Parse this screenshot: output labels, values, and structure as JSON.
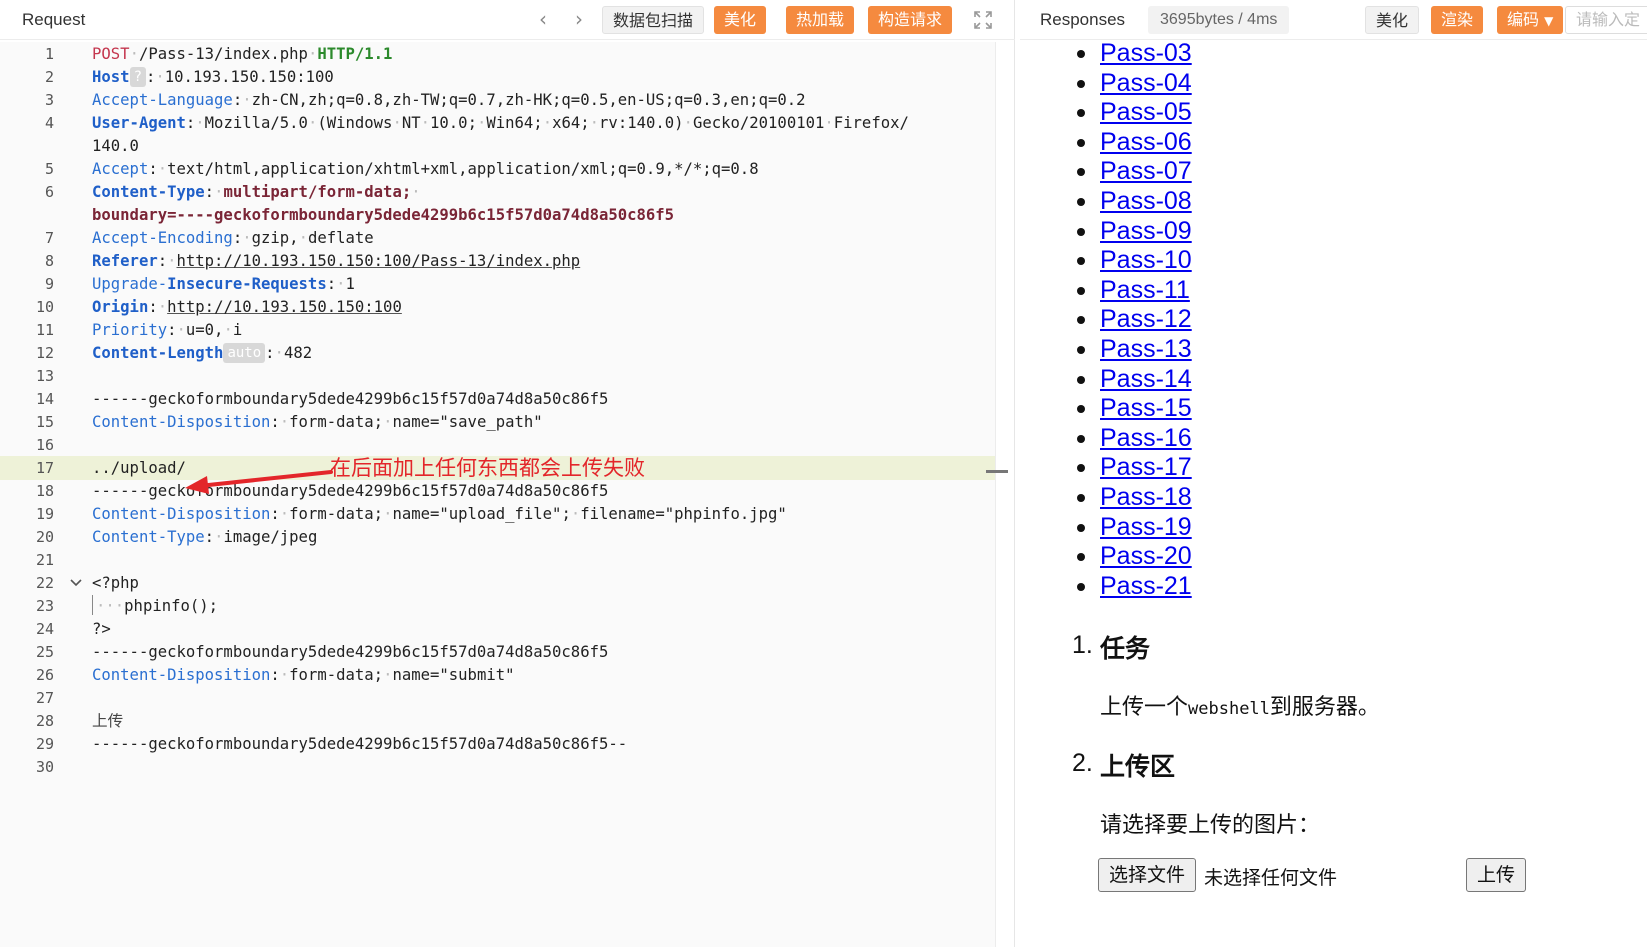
{
  "request": {
    "title": "Request",
    "toolbar": {
      "prev_icon": "chevron-left-icon",
      "next_icon": "chevron-right-icon",
      "scan": "数据包扫描",
      "beautify": "美化",
      "hot_load": "热加载",
      "build": "构造请求",
      "expand_icon": "expand-icon"
    },
    "lines": [
      {
        "n": "1",
        "tokens": [
          {
            "t": "POST",
            "c": "k-method"
          },
          {
            "t": "·",
            "c": "dot"
          },
          {
            "t": "/Pass-13/index.php",
            "c": "k-val"
          },
          {
            "t": "·",
            "c": "dot"
          },
          {
            "t": "HTTP/1.1",
            "c": "k-proto"
          }
        ]
      },
      {
        "n": "2",
        "tokens": [
          {
            "t": "Host",
            "c": "k-hdr-b"
          },
          {
            "t": "?",
            "c": "badge"
          },
          {
            "t": ":",
            "c": "k-val"
          },
          {
            "t": "·",
            "c": "dot"
          },
          {
            "t": "10.193.150.150:100",
            "c": "k-val"
          }
        ]
      },
      {
        "n": "3",
        "tokens": [
          {
            "t": "Accept-Language",
            "c": "k-hdr"
          },
          {
            "t": ":",
            "c": "k-val"
          },
          {
            "t": "·",
            "c": "dot"
          },
          {
            "t": "zh-CN,zh;q=0.8,zh-TW;q=0.7,zh-HK;q=0.5,en-US;q=0.3,en;q=0.2",
            "c": "k-val"
          }
        ]
      },
      {
        "n": "4",
        "tokens": [
          {
            "t": "User-Agent",
            "c": "k-hdr-b"
          },
          {
            "t": ":",
            "c": "k-val"
          },
          {
            "t": "·",
            "c": "dot"
          },
          {
            "t": "Mozilla/5.0",
            "c": "k-val"
          },
          {
            "t": "·",
            "c": "dot"
          },
          {
            "t": "(Windows",
            "c": "k-val"
          },
          {
            "t": "·",
            "c": "dot"
          },
          {
            "t": "NT",
            "c": "k-val"
          },
          {
            "t": "·",
            "c": "dot"
          },
          {
            "t": "10.0;",
            "c": "k-val"
          },
          {
            "t": "·",
            "c": "dot"
          },
          {
            "t": "Win64;",
            "c": "k-val"
          },
          {
            "t": "·",
            "c": "dot"
          },
          {
            "t": "x64;",
            "c": "k-val"
          },
          {
            "t": "·",
            "c": "dot"
          },
          {
            "t": "rv:140.0)",
            "c": "k-val"
          },
          {
            "t": "·",
            "c": "dot"
          },
          {
            "t": "Gecko/20100101",
            "c": "k-val"
          },
          {
            "t": "·",
            "c": "dot"
          },
          {
            "t": "Firefox/",
            "c": "k-val"
          }
        ]
      },
      {
        "n": "",
        "tokens": [
          {
            "t": "140.0",
            "c": "k-val"
          }
        ]
      },
      {
        "n": "5",
        "tokens": [
          {
            "t": "Accept",
            "c": "k-hdr"
          },
          {
            "t": ":",
            "c": "k-val"
          },
          {
            "t": "·",
            "c": "dot"
          },
          {
            "t": "text/html,application/xhtml+xml,application/xml;q=0.9,*/*;q=0.8",
            "c": "k-val"
          }
        ]
      },
      {
        "n": "6",
        "tokens": [
          {
            "t": "Content-Type",
            "c": "k-hdr-b"
          },
          {
            "t": ":",
            "c": "k-val"
          },
          {
            "t": "·",
            "c": "dot"
          },
          {
            "t": "multipart/form-data;",
            "c": "k-bval"
          },
          {
            "t": "·",
            "c": "dot"
          }
        ]
      },
      {
        "n": "",
        "tokens": [
          {
            "t": "boundary=----geckoformboundary5dede4299b6c15f57d0a74d8a50c86f5",
            "c": "k-bval"
          }
        ]
      },
      {
        "n": "7",
        "tokens": [
          {
            "t": "Accept-Encoding",
            "c": "k-hdr"
          },
          {
            "t": ":",
            "c": "k-val"
          },
          {
            "t": "·",
            "c": "dot"
          },
          {
            "t": "gzip,",
            "c": "k-val"
          },
          {
            "t": "·",
            "c": "dot"
          },
          {
            "t": "deflate",
            "c": "k-val"
          }
        ]
      },
      {
        "n": "8",
        "tokens": [
          {
            "t": "Referer",
            "c": "k-hdr-b"
          },
          {
            "t": ":",
            "c": "k-val"
          },
          {
            "t": "·",
            "c": "dot"
          },
          {
            "t": "http://10.193.150.150:100/Pass-13/index.php",
            "c": "k-url"
          }
        ]
      },
      {
        "n": "9",
        "tokens": [
          {
            "t": "Upgrade-",
            "c": "k-hdr"
          },
          {
            "t": "Insecure-Requests",
            "c": "k-hdr-b"
          },
          {
            "t": ":",
            "c": "k-val"
          },
          {
            "t": "·",
            "c": "dot"
          },
          {
            "t": "1",
            "c": "k-val"
          }
        ]
      },
      {
        "n": "10",
        "tokens": [
          {
            "t": "Origin",
            "c": "k-hdr-b"
          },
          {
            "t": ":",
            "c": "k-val"
          },
          {
            "t": "·",
            "c": "dot"
          },
          {
            "t": "http://10.193.150.150:100",
            "c": "k-url"
          }
        ]
      },
      {
        "n": "11",
        "tokens": [
          {
            "t": "Priority",
            "c": "k-hdr"
          },
          {
            "t": ":",
            "c": "k-val"
          },
          {
            "t": "·",
            "c": "dot"
          },
          {
            "t": "u=0,",
            "c": "k-val"
          },
          {
            "t": "·",
            "c": "dot"
          },
          {
            "t": "i",
            "c": "k-val"
          }
        ]
      },
      {
        "n": "12",
        "tokens": [
          {
            "t": "Content-Length",
            "c": "k-hdr-b"
          },
          {
            "t": "auto",
            "c": "badge"
          },
          {
            "t": ":",
            "c": "k-val"
          },
          {
            "t": "·",
            "c": "dot"
          },
          {
            "t": "482",
            "c": "k-val"
          }
        ]
      },
      {
        "n": "13",
        "tokens": []
      },
      {
        "n": "14",
        "tokens": [
          {
            "t": "------geckoformboundary5dede4299b6c15f57d0a74d8a50c86f5",
            "c": "k-val"
          }
        ]
      },
      {
        "n": "15",
        "tokens": [
          {
            "t": "Content-Disposition",
            "c": "k-hdr"
          },
          {
            "t": ":",
            "c": "k-val"
          },
          {
            "t": "·",
            "c": "dot"
          },
          {
            "t": "form-data;",
            "c": "k-val"
          },
          {
            "t": "·",
            "c": "dot"
          },
          {
            "t": "name=\"save_path\"",
            "c": "k-val"
          }
        ]
      },
      {
        "n": "16",
        "tokens": []
      },
      {
        "n": "17",
        "hl": true,
        "tokens": [
          {
            "t": "../upload/",
            "c": "k-val"
          }
        ]
      },
      {
        "n": "18",
        "tokens": [
          {
            "t": "------geckoformboundary5dede4299b6c15f57d0a74d8a50c86f5",
            "c": "k-val"
          }
        ]
      },
      {
        "n": "19",
        "tokens": [
          {
            "t": "Content-Disposition",
            "c": "k-hdr"
          },
          {
            "t": ":",
            "c": "k-val"
          },
          {
            "t": "·",
            "c": "dot"
          },
          {
            "t": "form-data;",
            "c": "k-val"
          },
          {
            "t": "·",
            "c": "dot"
          },
          {
            "t": "name=\"upload_file\";",
            "c": "k-val"
          },
          {
            "t": "·",
            "c": "dot"
          },
          {
            "t": "filename=\"phpinfo.jpg\"",
            "c": "k-val"
          }
        ]
      },
      {
        "n": "20",
        "tokens": [
          {
            "t": "Content-Type",
            "c": "k-hdr"
          },
          {
            "t": ":",
            "c": "k-val"
          },
          {
            "t": "·",
            "c": "dot"
          },
          {
            "t": "image/jpeg",
            "c": "k-val"
          }
        ]
      },
      {
        "n": "21",
        "tokens": []
      },
      {
        "n": "22",
        "fold": true,
        "tokens": [
          {
            "t": "<?php",
            "c": "k-val"
          }
        ]
      },
      {
        "n": "23",
        "indent": true,
        "tokens": [
          {
            "t": "···",
            "c": "dot"
          },
          {
            "t": "phpinfo();",
            "c": "k-val"
          }
        ]
      },
      {
        "n": "24",
        "tokens": [
          {
            "t": "?>",
            "c": "k-val"
          }
        ]
      },
      {
        "n": "25",
        "tokens": [
          {
            "t": "------geckoformboundary5dede4299b6c15f57d0a74d8a50c86f5",
            "c": "k-val"
          }
        ]
      },
      {
        "n": "26",
        "tokens": [
          {
            "t": "Content-Disposition",
            "c": "k-hdr"
          },
          {
            "t": ":",
            "c": "k-val"
          },
          {
            "t": "·",
            "c": "dot"
          },
          {
            "t": "form-data;",
            "c": "k-val"
          },
          {
            "t": "·",
            "c": "dot"
          },
          {
            "t": "name=\"submit\"",
            "c": "k-val"
          }
        ]
      },
      {
        "n": "27",
        "tokens": []
      },
      {
        "n": "28",
        "tokens": [
          {
            "t": "上传",
            "c": "k-cn"
          }
        ]
      },
      {
        "n": "29",
        "tokens": [
          {
            "t": "------geckoformboundary5dede4299b6c15f57d0a74d8a50c86f5--",
            "c": "k-val"
          }
        ]
      },
      {
        "n": "30",
        "tokens": []
      }
    ],
    "annotation": {
      "text": "在后面加上任何东西都会上传失败",
      "color": "#e3262a",
      "arrow_icon": "red-arrow-icon"
    }
  },
  "responses": {
    "title": "Responses",
    "meta": "3695bytes / 4ms",
    "toolbar": {
      "beautify": "美化",
      "render": "渲染",
      "encode": "编码",
      "search_placeholder": "请输入定"
    },
    "links": [
      "Pass-03",
      "Pass-04",
      "Pass-05",
      "Pass-06",
      "Pass-07",
      "Pass-08",
      "Pass-09",
      "Pass-10",
      "Pass-11",
      "Pass-12",
      "Pass-13",
      "Pass-14",
      "Pass-15",
      "Pass-16",
      "Pass-17",
      "Pass-18",
      "Pass-19",
      "Pass-20",
      "Pass-21"
    ],
    "section1": {
      "num": "1.",
      "title": "任务",
      "text_pre": "上传一个",
      "text_mono": "webshell",
      "text_post": "到服务器。"
    },
    "section2": {
      "num": "2.",
      "title": "上传区",
      "prompt": "请选择要上传的图片："
    },
    "file_input": {
      "choose": "选择文件",
      "none": "未选择任何文件",
      "upload": "上传"
    }
  },
  "colors": {
    "accent_orange": "#f58a3f",
    "link_blue": "#0000ee",
    "highlight_line": "#eef2d8"
  }
}
